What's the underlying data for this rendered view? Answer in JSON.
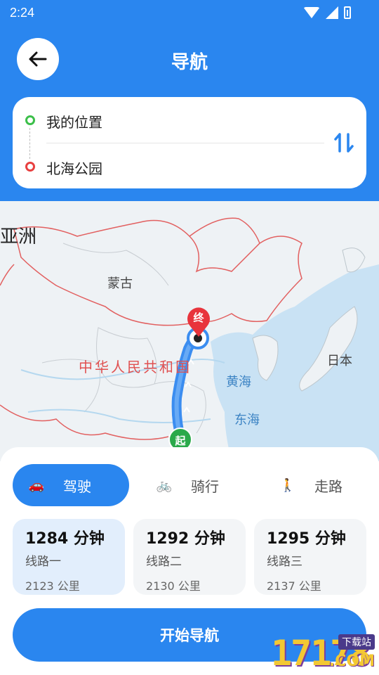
{
  "status_bar": {
    "time": "2:24"
  },
  "header": {
    "title": "导航"
  },
  "route": {
    "from": "我的位置",
    "to": "北海公园"
  },
  "map": {
    "labels": {
      "continent": "亚洲",
      "mongolia": "蒙古",
      "china": "中华人民共和国",
      "yellow_sea": "黄海",
      "east_sea": "东海",
      "japan": "日本"
    },
    "start_marker": "起",
    "end_marker": "终"
  },
  "modes": [
    {
      "label": "驾驶",
      "icon": "car-icon",
      "active": true
    },
    {
      "label": "骑行",
      "icon": "bicycle-icon",
      "active": false
    },
    {
      "label": "走路",
      "icon": "walking-person-icon",
      "active": false
    }
  ],
  "routes": [
    {
      "duration": "1284 分钟",
      "name": "线路一",
      "distance": "2123 公里",
      "selected": true
    },
    {
      "duration": "1292 分钟",
      "name": "线路二",
      "distance": "2130 公里",
      "selected": false
    },
    {
      "duration": "1295 分钟",
      "name": "线路三",
      "distance": "2137 公里",
      "selected": false
    }
  ],
  "start_button": "开始导航",
  "watermark": {
    "digits": "17178",
    "tag": "下载站",
    "suffix": ".COM"
  },
  "colors": {
    "primary": "#2a86ef",
    "start_green": "#3cbf4a",
    "end_red": "#e84040",
    "route_blue": "#3b8df0"
  }
}
